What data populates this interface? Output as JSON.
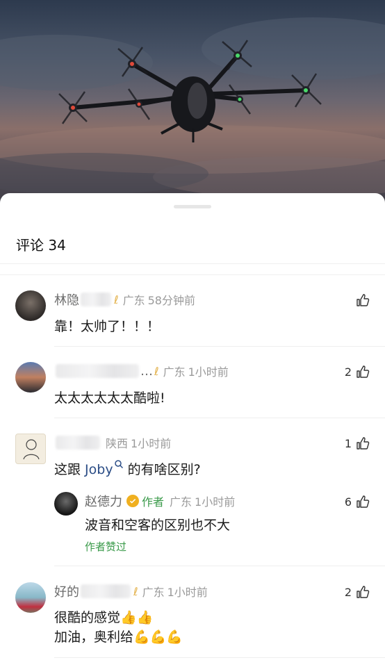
{
  "sheet": {
    "title": "评论 34"
  },
  "comments": [
    {
      "name": "林隐",
      "location": "广东",
      "time": "58分钟前",
      "text": "靠！太帅了！！！",
      "likes": ""
    },
    {
      "name": "…",
      "location": "广东",
      "time": "1小时前",
      "text": "太太太太太太酷啦!",
      "likes": "2"
    },
    {
      "name": "",
      "location": "陕西",
      "time": "1小时前",
      "text_before": "这跟 ",
      "link": "Joby",
      "text_after": " 的有啥区别?",
      "likes": "1",
      "reply": {
        "name": "赵德力",
        "author_tag": "作者",
        "location": "广东",
        "time": "1小时前",
        "text": "波音和空客的区别也不大",
        "likes": "6",
        "liked_by": "作者赞过"
      }
    },
    {
      "name": "好的",
      "location": "广东",
      "time": "1小时前",
      "line1": "很酷的感觉👍👍",
      "line2": "加油，奥利给💪💪💪",
      "likes": "2"
    }
  ],
  "icons": {
    "like": "thumb-up-icon",
    "badge": "vip-badge-icon",
    "search": "search-icon",
    "verified": "verified-icon"
  },
  "colors": {
    "accent_green": "#3a9a4a",
    "link": "#2b4d86",
    "badge": "#e3b24d"
  }
}
